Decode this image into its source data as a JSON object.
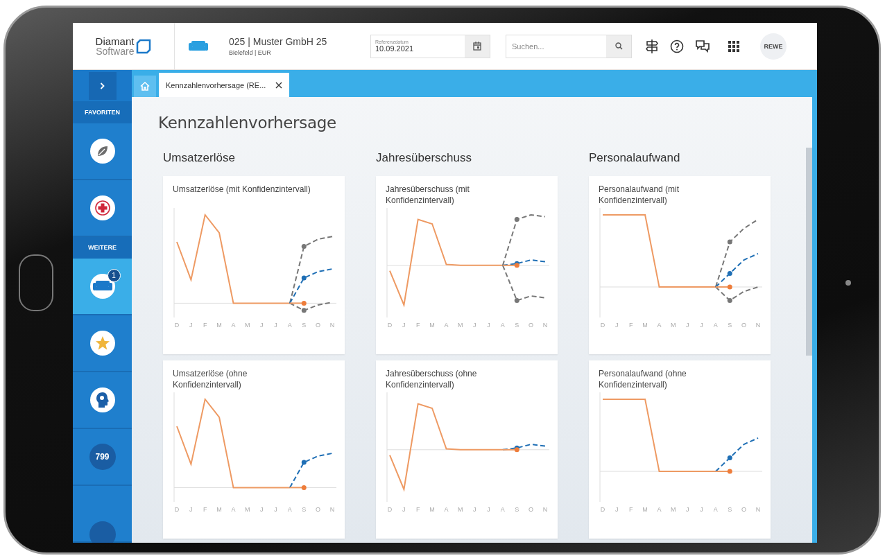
{
  "header": {
    "logo": {
      "line1": "Diamant",
      "line2": "Software"
    },
    "company": {
      "title": "025 | Muster GmbH 25",
      "subtitle": "Bielefeld | EUR"
    },
    "reference_date": {
      "label": "Referenzdatum",
      "value": "10.09.2021"
    },
    "search": {
      "placeholder": "Suchen..."
    },
    "user": "REWE"
  },
  "tabs": [
    {
      "label": "Kennzahlenvorhersage (RE...",
      "selected": true
    }
  ],
  "sidebar": {
    "groups": [
      {
        "label": "FAVORITEN",
        "items": [
          {
            "kind": "leaf",
            "selected": false
          },
          {
            "kind": "cross",
            "selected": false
          }
        ]
      },
      {
        "label": "WEITERE",
        "items": [
          {
            "kind": "sofa",
            "selected": true,
            "badge": "1"
          },
          {
            "kind": "star",
            "selected": false
          },
          {
            "kind": "head",
            "selected": false
          },
          {
            "kind": "count",
            "selected": false,
            "text": "799"
          },
          {
            "kind": "partial",
            "selected": false
          }
        ]
      }
    ]
  },
  "page": {
    "title": "Kennzahlenvorhersage",
    "columns": [
      {
        "heading": "Umsatzerlöse",
        "charts": [
          {
            "title": "Umsatzerlöse (mit Konfidenzintervall)",
            "kind": "with_interval",
            "x_labels": [
              "D",
              "J",
              "F",
              "M",
              "A",
              "M",
              "J",
              "J",
              "A",
              "S",
              "O",
              "N"
            ]
          },
          {
            "title": "Umsatzerlöse (ohne Konfidenzintervall)",
            "kind": "without_interval",
            "x_labels": [
              "D",
              "J",
              "F",
              "M",
              "A",
              "M",
              "J",
              "J",
              "A",
              "S",
              "O",
              "N"
            ]
          }
        ]
      },
      {
        "heading": "Jahresüberschuss",
        "charts": [
          {
            "title": "Jahresüberschuss (mit Konfidenzintervall)",
            "kind": "with_interval",
            "x_labels": [
              "D",
              "J",
              "F",
              "M",
              "A",
              "M",
              "J",
              "J",
              "A",
              "S",
              "O",
              "N"
            ]
          },
          {
            "title": "Jahresüberschuss (ohne Konfidenzintervall)",
            "kind": "without_interval",
            "x_labels": [
              "D",
              "J",
              "F",
              "M",
              "A",
              "M",
              "J",
              "J",
              "A",
              "S",
              "O",
              "N"
            ]
          }
        ]
      },
      {
        "heading": "Personalaufwand",
        "charts": [
          {
            "title": "Personalaufwand (mit Konfidenzintervall)",
            "kind": "with_interval",
            "x_labels": [
              "D",
              "J",
              "F",
              "M",
              "A",
              "M",
              "J",
              "J",
              "A",
              "S",
              "O",
              "N"
            ]
          },
          {
            "title": "Personalaufwand (ohne Konfidenzintervall)",
            "kind": "without_interval",
            "x_labels": [
              "D",
              "J",
              "F",
              "M",
              "A",
              "M",
              "J",
              "J",
              "A",
              "S",
              "O",
              "N"
            ]
          }
        ]
      }
    ]
  }
}
